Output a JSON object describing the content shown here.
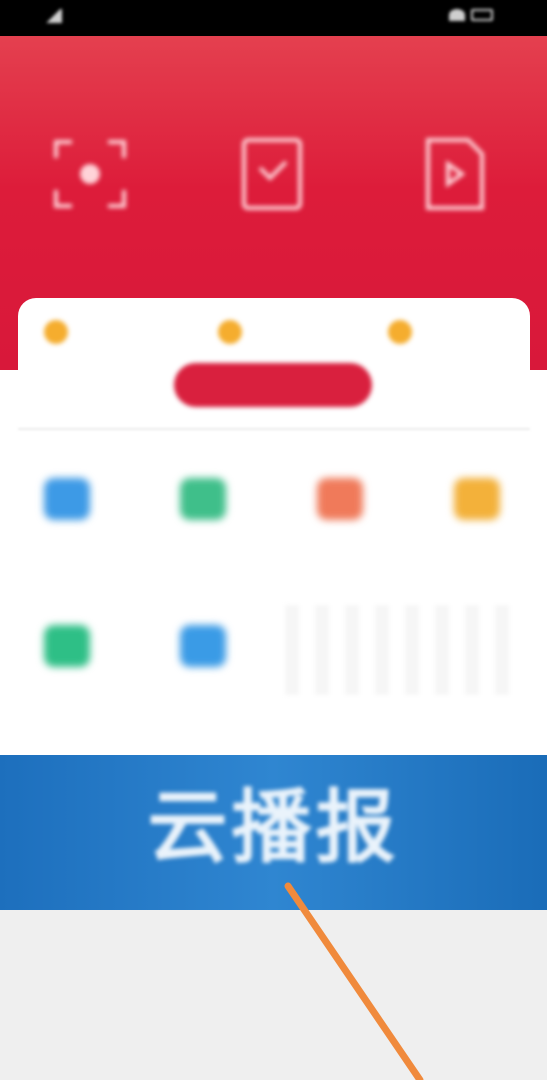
{
  "status_bar": {
    "left_text": "",
    "right_text": ""
  },
  "header": {
    "title": "",
    "features": [
      {
        "label": "",
        "icon": "scan-icon"
      },
      {
        "label": "",
        "icon": "shield-icon"
      },
      {
        "label": "",
        "icon": "document-icon"
      }
    ]
  },
  "card": {
    "categories": [
      {
        "label": "",
        "icon": "star-icon"
      },
      {
        "label": "",
        "icon": "star-icon"
      },
      {
        "label": "",
        "icon": "star-icon"
      }
    ],
    "pill_label": ""
  },
  "grid": {
    "items": [
      {
        "label": "",
        "color": "#3d9ae6"
      },
      {
        "label": "",
        "color": "#3fbf8a"
      },
      {
        "label": "",
        "color": "#f07a5a"
      },
      {
        "label": "",
        "color": "#f3b13a"
      },
      {
        "label": "",
        "color": "#2ebf86"
      },
      {
        "label": "",
        "color": "#3a9be6"
      }
    ]
  },
  "banner": {
    "title": "云播报",
    "subtitle": ""
  },
  "colors": {
    "header_red": "#dd1c3a",
    "banner_blue": "#2f86d1",
    "accent_orange": "#f08a3c"
  }
}
